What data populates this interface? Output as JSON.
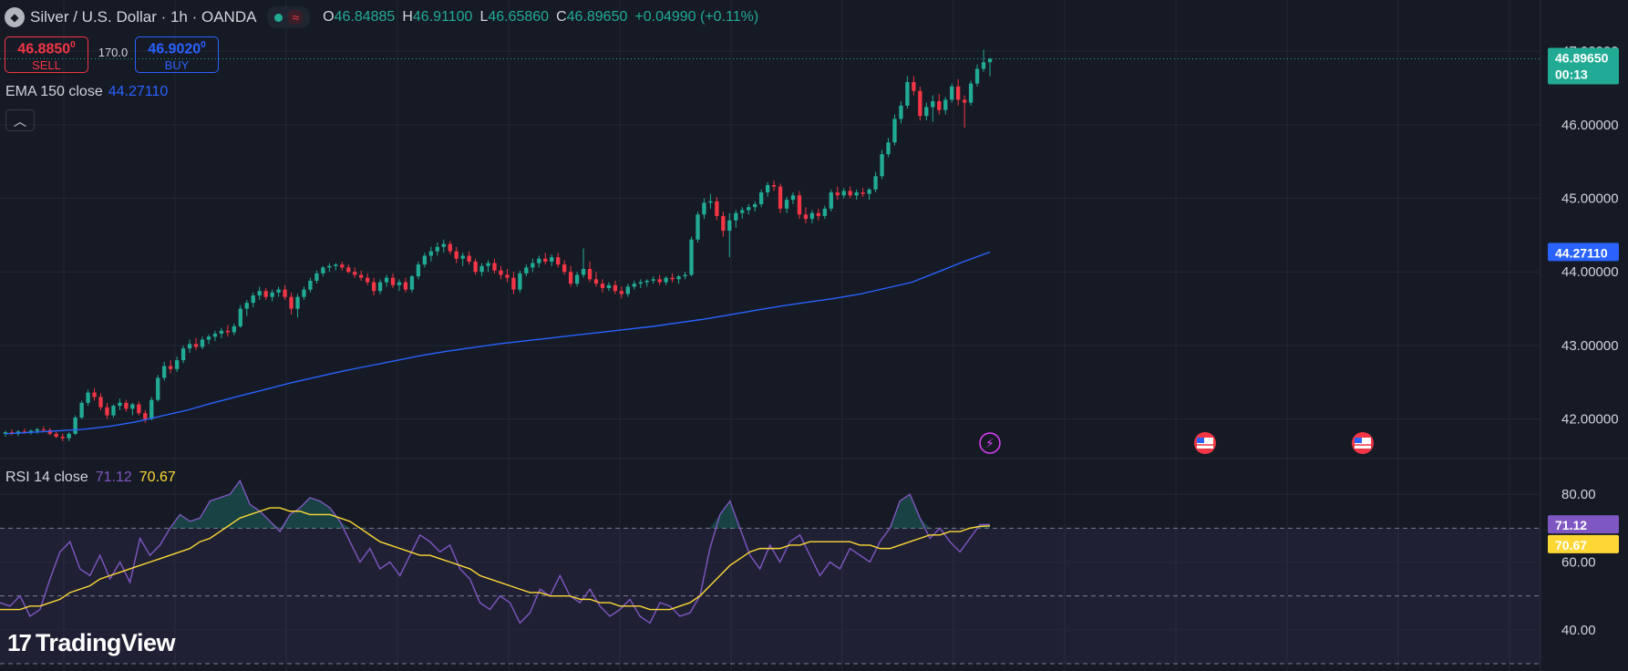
{
  "header": {
    "symbol_icon": "silver-coin-icon",
    "title": "Silver / U.S. Dollar · 1h · OANDA",
    "status_icon": "market-open-dot-icon",
    "wave_icon": "wave-icon",
    "ohlc": {
      "o_label": "O",
      "o_value": "46.84885",
      "h_label": "H",
      "h_value": "46.91100",
      "l_label": "L",
      "l_value": "46.65860",
      "c_label": "C",
      "c_value": "46.89650",
      "change": "+0.04990 (+0.11%)"
    }
  },
  "trade": {
    "sell_price": "46.8850",
    "sell_price_sup": "0",
    "sell_label": "SELL",
    "spread": "170.0",
    "buy_price": "46.9020",
    "buy_price_sup": "0",
    "buy_label": "BUY"
  },
  "ema_legend": {
    "name": "EMA 150 close",
    "value": "44.27110"
  },
  "collapse_icon": "chevron-up-icon",
  "rsi_legend": {
    "name": "RSI 14 close",
    "value1": "71.12",
    "value2": "70.67"
  },
  "price_axis_labels": [
    "47.00000",
    "46.00000",
    "45.00000",
    "44.00000",
    "43.00000",
    "42.00000"
  ],
  "rsi_axis_labels": [
    "80.00",
    "60.00",
    "40.00"
  ],
  "tags": {
    "last_price": "46.89650",
    "countdown": "00:13",
    "ema": "44.27110",
    "rsi": "71.12",
    "rsi_ma": "70.67"
  },
  "colors": {
    "background": "#161a25",
    "up": "#22ab94",
    "down": "#f23645",
    "ema": "#2962ff",
    "rsi": "#7e57c2",
    "rsi_ma": "#fdd835",
    "grid": "#232733"
  },
  "event_icons": [
    "lightning-icon",
    "us-flag-icon",
    "us-flag-icon"
  ],
  "logo": "TradingView",
  "chart_data": {
    "type": "candlestick",
    "timeframe": "1h",
    "price_ylim": [
      41.5,
      47.2
    ],
    "rsi_ylim": [
      30,
      90
    ],
    "rsi_bands": [
      70,
      50,
      30
    ],
    "candles": [
      [
        41.8,
        41.84,
        41.76,
        41.82
      ],
      [
        41.82,
        41.86,
        41.78,
        41.8
      ],
      [
        41.8,
        41.85,
        41.77,
        41.83
      ],
      [
        41.83,
        41.87,
        41.8,
        41.82
      ],
      [
        41.82,
        41.86,
        41.79,
        41.84
      ],
      [
        41.84,
        41.88,
        41.8,
        41.86
      ],
      [
        41.86,
        41.9,
        41.82,
        41.85
      ],
      [
        41.85,
        41.88,
        41.78,
        41.8
      ],
      [
        41.8,
        41.83,
        41.74,
        41.76
      ],
      [
        41.76,
        41.8,
        41.7,
        41.74
      ],
      [
        41.74,
        41.82,
        41.7,
        41.8
      ],
      [
        41.8,
        42.05,
        41.78,
        42.02
      ],
      [
        42.02,
        42.25,
        42.0,
        42.22
      ],
      [
        42.22,
        42.4,
        42.18,
        42.36
      ],
      [
        42.36,
        42.42,
        42.25,
        42.3
      ],
      [
        42.3,
        42.35,
        42.12,
        42.16
      ],
      [
        42.16,
        42.22,
        42.0,
        42.05
      ],
      [
        42.05,
        42.2,
        42.02,
        42.18
      ],
      [
        42.18,
        42.28,
        42.12,
        42.22
      ],
      [
        42.22,
        42.26,
        42.1,
        42.14
      ],
      [
        42.14,
        42.22,
        42.05,
        42.2
      ],
      [
        42.2,
        42.24,
        42.05,
        42.08
      ],
      [
        42.08,
        42.12,
        41.95,
        42.0
      ],
      [
        42.0,
        42.3,
        41.98,
        42.26
      ],
      [
        42.26,
        42.6,
        42.24,
        42.56
      ],
      [
        42.56,
        42.78,
        42.52,
        42.72
      ],
      [
        42.72,
        42.8,
        42.62,
        42.68
      ],
      [
        42.68,
        42.85,
        42.64,
        42.8
      ],
      [
        42.8,
        43.0,
        42.76,
        42.96
      ],
      [
        42.96,
        43.08,
        42.9,
        43.02
      ],
      [
        43.02,
        43.1,
        42.94,
        42.98
      ],
      [
        42.98,
        43.12,
        42.95,
        43.08
      ],
      [
        43.08,
        43.15,
        43.02,
        43.12
      ],
      [
        43.12,
        43.2,
        43.06,
        43.16
      ],
      [
        43.16,
        43.24,
        43.1,
        43.2
      ],
      [
        43.2,
        43.28,
        43.12,
        43.18
      ],
      [
        43.18,
        43.3,
        43.14,
        43.26
      ],
      [
        43.26,
        43.55,
        43.24,
        43.5
      ],
      [
        43.5,
        43.62,
        43.4,
        43.58
      ],
      [
        43.58,
        43.72,
        43.52,
        43.68
      ],
      [
        43.68,
        43.8,
        43.62,
        43.74
      ],
      [
        43.74,
        43.78,
        43.62,
        43.66
      ],
      [
        43.66,
        43.76,
        43.6,
        43.72
      ],
      [
        43.72,
        43.8,
        43.66,
        43.76
      ],
      [
        43.76,
        43.82,
        43.62,
        43.66
      ],
      [
        43.66,
        43.72,
        43.42,
        43.5
      ],
      [
        43.5,
        43.7,
        43.38,
        43.66
      ],
      [
        43.66,
        43.8,
        43.62,
        43.76
      ],
      [
        43.76,
        43.92,
        43.72,
        43.88
      ],
      [
        43.88,
        44.02,
        43.84,
        43.98
      ],
      [
        43.98,
        44.08,
        43.94,
        44.06
      ],
      [
        44.06,
        44.12,
        44.0,
        44.08
      ],
      [
        44.08,
        44.12,
        44.02,
        44.1
      ],
      [
        44.1,
        44.14,
        44.02,
        44.06
      ],
      [
        44.06,
        44.1,
        43.98,
        44.0
      ],
      [
        44.0,
        44.06,
        43.92,
        43.96
      ],
      [
        43.96,
        44.02,
        43.88,
        43.92
      ],
      [
        43.92,
        43.98,
        43.82,
        43.86
      ],
      [
        43.86,
        43.92,
        43.68,
        43.74
      ],
      [
        43.74,
        43.9,
        43.7,
        43.86
      ],
      [
        43.86,
        43.96,
        43.8,
        43.92
      ],
      [
        43.92,
        43.98,
        43.78,
        43.82
      ],
      [
        43.82,
        43.9,
        43.74,
        43.86
      ],
      [
        43.86,
        43.92,
        43.72,
        43.76
      ],
      [
        43.76,
        43.96,
        43.72,
        43.94
      ],
      [
        43.94,
        44.14,
        43.9,
        44.1
      ],
      [
        44.1,
        44.26,
        44.06,
        44.22
      ],
      [
        44.22,
        44.34,
        44.14,
        44.28
      ],
      [
        44.28,
        44.4,
        44.22,
        44.34
      ],
      [
        44.34,
        44.44,
        44.26,
        44.38
      ],
      [
        44.38,
        44.42,
        44.24,
        44.28
      ],
      [
        44.28,
        44.34,
        44.12,
        44.18
      ],
      [
        44.18,
        44.26,
        44.08,
        44.22
      ],
      [
        44.22,
        44.28,
        44.1,
        44.14
      ],
      [
        44.14,
        44.18,
        43.96,
        44.0
      ],
      [
        44.0,
        44.12,
        43.94,
        44.08
      ],
      [
        44.08,
        44.16,
        44.0,
        44.12
      ],
      [
        44.12,
        44.18,
        43.98,
        44.02
      ],
      [
        44.02,
        44.08,
        43.9,
        43.96
      ],
      [
        43.96,
        44.04,
        43.86,
        43.92
      ],
      [
        43.92,
        44.0,
        43.7,
        43.76
      ],
      [
        43.76,
        44.02,
        43.72,
        43.98
      ],
      [
        43.98,
        44.1,
        43.94,
        44.06
      ],
      [
        44.06,
        44.18,
        44.0,
        44.12
      ],
      [
        44.12,
        44.22,
        44.06,
        44.18
      ],
      [
        44.18,
        44.26,
        44.1,
        44.14
      ],
      [
        44.14,
        44.24,
        44.08,
        44.2
      ],
      [
        44.2,
        44.26,
        44.06,
        44.1
      ],
      [
        44.1,
        44.16,
        43.96,
        44.0
      ],
      [
        44.0,
        44.08,
        43.8,
        43.84
      ],
      [
        43.84,
        44.0,
        43.8,
        43.96
      ],
      [
        43.96,
        44.32,
        43.92,
        44.04
      ],
      [
        44.04,
        44.14,
        43.86,
        43.9
      ],
      [
        43.9,
        44.0,
        43.8,
        43.84
      ],
      [
        43.84,
        43.9,
        43.72,
        43.78
      ],
      [
        43.78,
        43.86,
        43.74,
        43.82
      ],
      [
        43.82,
        43.88,
        43.7,
        43.74
      ],
      [
        43.74,
        43.8,
        43.64,
        43.7
      ],
      [
        43.7,
        43.84,
        43.66,
        43.8
      ],
      [
        43.8,
        43.88,
        43.76,
        43.84
      ],
      [
        43.84,
        43.9,
        43.78,
        43.86
      ],
      [
        43.86,
        43.9,
        43.8,
        43.88
      ],
      [
        43.88,
        43.94,
        43.84,
        43.9
      ],
      [
        43.9,
        43.96,
        43.82,
        43.86
      ],
      [
        43.86,
        43.94,
        43.82,
        43.92
      ],
      [
        43.92,
        43.98,
        43.86,
        43.9
      ],
      [
        43.9,
        43.96,
        43.84,
        43.94
      ],
      [
        43.94,
        44.0,
        43.9,
        43.96
      ],
      [
        43.96,
        44.48,
        43.94,
        44.44
      ],
      [
        44.44,
        44.82,
        44.4,
        44.78
      ],
      [
        44.78,
        45.0,
        44.72,
        44.94
      ],
      [
        44.94,
        45.06,
        44.86,
        44.96
      ],
      [
        44.96,
        45.02,
        44.7,
        44.76
      ],
      [
        44.76,
        44.82,
        44.48,
        44.56
      ],
      [
        44.56,
        44.8,
        44.2,
        44.7
      ],
      [
        44.7,
        44.84,
        44.6,
        44.8
      ],
      [
        44.8,
        44.88,
        44.72,
        44.84
      ],
      [
        44.84,
        44.92,
        44.78,
        44.88
      ],
      [
        44.88,
        44.96,
        44.82,
        44.92
      ],
      [
        44.92,
        45.12,
        44.88,
        45.08
      ],
      [
        45.08,
        45.22,
        45.02,
        45.18
      ],
      [
        45.18,
        45.24,
        45.1,
        45.16
      ],
      [
        45.16,
        45.2,
        44.8,
        44.86
      ],
      [
        44.86,
        45.02,
        44.8,
        44.98
      ],
      [
        44.98,
        45.08,
        44.92,
        45.04
      ],
      [
        45.04,
        45.1,
        44.72,
        44.78
      ],
      [
        44.78,
        44.88,
        44.66,
        44.72
      ],
      [
        44.72,
        44.84,
        44.66,
        44.8
      ],
      [
        44.8,
        44.86,
        44.7,
        44.76
      ],
      [
        44.76,
        44.9,
        44.72,
        44.86
      ],
      [
        44.86,
        45.12,
        44.82,
        45.08
      ],
      [
        45.08,
        45.16,
        44.98,
        45.04
      ],
      [
        45.04,
        45.14,
        45.0,
        45.1
      ],
      [
        45.1,
        45.16,
        45.0,
        45.04
      ],
      [
        45.04,
        45.12,
        44.98,
        45.08
      ],
      [
        45.08,
        45.14,
        45.02,
        45.06
      ],
      [
        45.06,
        45.14,
        44.98,
        45.12
      ],
      [
        45.12,
        45.36,
        45.08,
        45.3
      ],
      [
        45.3,
        45.66,
        45.26,
        45.6
      ],
      [
        45.6,
        45.82,
        45.56,
        45.76
      ],
      [
        45.76,
        46.14,
        45.72,
        46.08
      ],
      [
        46.08,
        46.32,
        46.02,
        46.26
      ],
      [
        46.26,
        46.66,
        46.22,
        46.58
      ],
      [
        46.58,
        46.66,
        46.4,
        46.46
      ],
      [
        46.46,
        46.52,
        46.06,
        46.12
      ],
      [
        46.12,
        46.3,
        46.06,
        46.24
      ],
      [
        46.24,
        46.4,
        46.04,
        46.32
      ],
      [
        46.32,
        46.42,
        46.14,
        46.2
      ],
      [
        46.2,
        46.38,
        46.14,
        46.34
      ],
      [
        46.34,
        46.56,
        46.3,
        46.52
      ],
      [
        46.52,
        46.62,
        46.26,
        46.34
      ],
      [
        46.34,
        46.4,
        45.96,
        46.3
      ],
      [
        46.3,
        46.6,
        46.26,
        46.56
      ],
      [
        46.56,
        46.82,
        46.52,
        46.76
      ],
      [
        46.76,
        47.02,
        46.72,
        46.85
      ],
      [
        46.85,
        46.91,
        46.66,
        46.8965
      ]
    ],
    "ema150": [
      41.8,
      41.82,
      41.84,
      41.86,
      41.9,
      41.96,
      42.04,
      42.12,
      42.22,
      42.31,
      42.4,
      42.49,
      42.57,
      42.65,
      42.72,
      42.79,
      42.86,
      42.92,
      42.97,
      43.02,
      43.06,
      43.1,
      43.14,
      43.18,
      43.22,
      43.26,
      43.31,
      43.36,
      43.42,
      43.48,
      43.54,
      43.59,
      43.64,
      43.7,
      43.78,
      43.86,
      44.0,
      44.14,
      44.27
    ],
    "rsi": [
      48,
      47,
      50,
      44,
      46,
      55,
      63,
      66,
      58,
      56,
      62,
      55,
      60,
      54,
      67,
      62,
      65,
      70,
      74,
      72,
      73,
      78,
      79,
      80,
      84,
      77,
      75,
      72,
      69,
      74,
      76,
      79,
      78,
      76,
      72,
      66,
      60,
      64,
      58,
      60,
      56,
      62,
      68,
      66,
      63,
      65,
      58,
      55,
      48,
      46,
      50,
      48,
      42,
      45,
      52,
      50,
      56,
      50,
      48,
      52,
      47,
      44,
      46,
      49,
      44,
      42,
      48,
      47,
      44,
      45,
      50,
      64,
      74,
      78,
      70,
      62,
      58,
      65,
      60,
      66,
      68,
      62,
      56,
      60,
      58,
      64,
      62,
      60,
      66,
      70,
      78,
      80,
      73,
      67,
      70,
      66,
      63,
      67,
      71,
      71.12
    ],
    "rsi_ma": [
      46,
      46,
      46,
      47,
      47,
      48,
      49,
      51,
      52,
      53,
      55,
      56,
      57,
      58,
      59,
      60,
      61,
      62,
      63,
      64,
      66,
      67,
      69,
      71,
      73,
      74,
      75,
      76,
      76,
      75,
      75,
      74,
      74,
      74,
      73,
      72,
      70,
      68,
      66,
      65,
      64,
      63,
      62,
      62,
      61,
      60,
      59,
      58,
      56,
      55,
      54,
      53,
      52,
      51,
      51,
      50,
      50,
      50,
      49,
      49,
      48,
      48,
      47,
      47,
      47,
      46,
      46,
      46,
      47,
      48,
      50,
      53,
      56,
      59,
      61,
      63,
      64,
      64,
      64,
      65,
      65,
      66,
      66,
      66,
      66,
      66,
      65,
      65,
      64,
      64,
      65,
      66,
      67,
      68,
      68,
      69,
      69,
      70,
      70.5,
      70.67
    ]
  }
}
